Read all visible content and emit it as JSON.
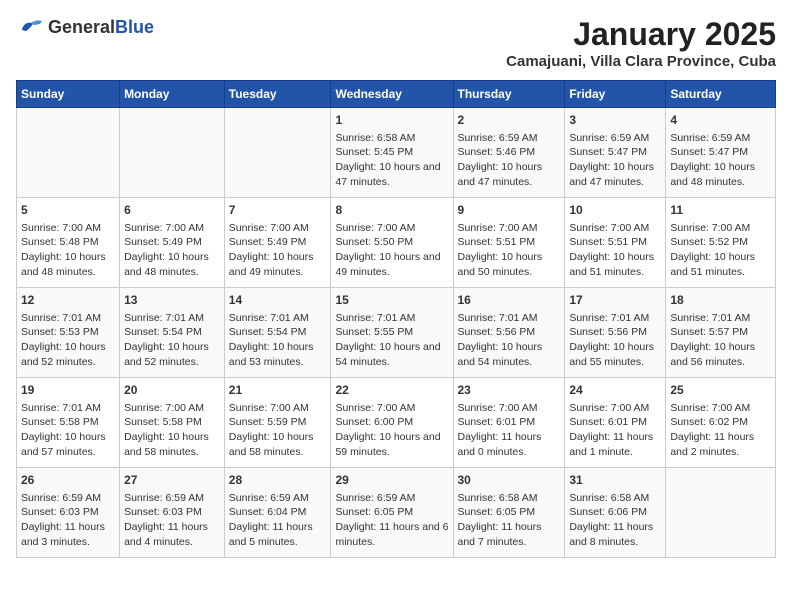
{
  "header": {
    "logo_general": "General",
    "logo_blue": "Blue",
    "title": "January 2025",
    "subtitle": "Camajuani, Villa Clara Province, Cuba"
  },
  "days_of_week": [
    "Sunday",
    "Monday",
    "Tuesday",
    "Wednesday",
    "Thursday",
    "Friday",
    "Saturday"
  ],
  "weeks": [
    [
      {
        "day": "",
        "content": ""
      },
      {
        "day": "",
        "content": ""
      },
      {
        "day": "",
        "content": ""
      },
      {
        "day": "1",
        "content": "Sunrise: 6:58 AM\nSunset: 5:45 PM\nDaylight: 10 hours and 47 minutes."
      },
      {
        "day": "2",
        "content": "Sunrise: 6:59 AM\nSunset: 5:46 PM\nDaylight: 10 hours and 47 minutes."
      },
      {
        "day": "3",
        "content": "Sunrise: 6:59 AM\nSunset: 5:47 PM\nDaylight: 10 hours and 47 minutes."
      },
      {
        "day": "4",
        "content": "Sunrise: 6:59 AM\nSunset: 5:47 PM\nDaylight: 10 hours and 48 minutes."
      }
    ],
    [
      {
        "day": "5",
        "content": "Sunrise: 7:00 AM\nSunset: 5:48 PM\nDaylight: 10 hours and 48 minutes."
      },
      {
        "day": "6",
        "content": "Sunrise: 7:00 AM\nSunset: 5:49 PM\nDaylight: 10 hours and 48 minutes."
      },
      {
        "day": "7",
        "content": "Sunrise: 7:00 AM\nSunset: 5:49 PM\nDaylight: 10 hours and 49 minutes."
      },
      {
        "day": "8",
        "content": "Sunrise: 7:00 AM\nSunset: 5:50 PM\nDaylight: 10 hours and 49 minutes."
      },
      {
        "day": "9",
        "content": "Sunrise: 7:00 AM\nSunset: 5:51 PM\nDaylight: 10 hours and 50 minutes."
      },
      {
        "day": "10",
        "content": "Sunrise: 7:00 AM\nSunset: 5:51 PM\nDaylight: 10 hours and 51 minutes."
      },
      {
        "day": "11",
        "content": "Sunrise: 7:00 AM\nSunset: 5:52 PM\nDaylight: 10 hours and 51 minutes."
      }
    ],
    [
      {
        "day": "12",
        "content": "Sunrise: 7:01 AM\nSunset: 5:53 PM\nDaylight: 10 hours and 52 minutes."
      },
      {
        "day": "13",
        "content": "Sunrise: 7:01 AM\nSunset: 5:54 PM\nDaylight: 10 hours and 52 minutes."
      },
      {
        "day": "14",
        "content": "Sunrise: 7:01 AM\nSunset: 5:54 PM\nDaylight: 10 hours and 53 minutes."
      },
      {
        "day": "15",
        "content": "Sunrise: 7:01 AM\nSunset: 5:55 PM\nDaylight: 10 hours and 54 minutes."
      },
      {
        "day": "16",
        "content": "Sunrise: 7:01 AM\nSunset: 5:56 PM\nDaylight: 10 hours and 54 minutes."
      },
      {
        "day": "17",
        "content": "Sunrise: 7:01 AM\nSunset: 5:56 PM\nDaylight: 10 hours and 55 minutes."
      },
      {
        "day": "18",
        "content": "Sunrise: 7:01 AM\nSunset: 5:57 PM\nDaylight: 10 hours and 56 minutes."
      }
    ],
    [
      {
        "day": "19",
        "content": "Sunrise: 7:01 AM\nSunset: 5:58 PM\nDaylight: 10 hours and 57 minutes."
      },
      {
        "day": "20",
        "content": "Sunrise: 7:00 AM\nSunset: 5:58 PM\nDaylight: 10 hours and 58 minutes."
      },
      {
        "day": "21",
        "content": "Sunrise: 7:00 AM\nSunset: 5:59 PM\nDaylight: 10 hours and 58 minutes."
      },
      {
        "day": "22",
        "content": "Sunrise: 7:00 AM\nSunset: 6:00 PM\nDaylight: 10 hours and 59 minutes."
      },
      {
        "day": "23",
        "content": "Sunrise: 7:00 AM\nSunset: 6:01 PM\nDaylight: 11 hours and 0 minutes."
      },
      {
        "day": "24",
        "content": "Sunrise: 7:00 AM\nSunset: 6:01 PM\nDaylight: 11 hours and 1 minute."
      },
      {
        "day": "25",
        "content": "Sunrise: 7:00 AM\nSunset: 6:02 PM\nDaylight: 11 hours and 2 minutes."
      }
    ],
    [
      {
        "day": "26",
        "content": "Sunrise: 6:59 AM\nSunset: 6:03 PM\nDaylight: 11 hours and 3 minutes."
      },
      {
        "day": "27",
        "content": "Sunrise: 6:59 AM\nSunset: 6:03 PM\nDaylight: 11 hours and 4 minutes."
      },
      {
        "day": "28",
        "content": "Sunrise: 6:59 AM\nSunset: 6:04 PM\nDaylight: 11 hours and 5 minutes."
      },
      {
        "day": "29",
        "content": "Sunrise: 6:59 AM\nSunset: 6:05 PM\nDaylight: 11 hours and 6 minutes."
      },
      {
        "day": "30",
        "content": "Sunrise: 6:58 AM\nSunset: 6:05 PM\nDaylight: 11 hours and 7 minutes."
      },
      {
        "day": "31",
        "content": "Sunrise: 6:58 AM\nSunset: 6:06 PM\nDaylight: 11 hours and 8 minutes."
      },
      {
        "day": "",
        "content": ""
      }
    ]
  ]
}
